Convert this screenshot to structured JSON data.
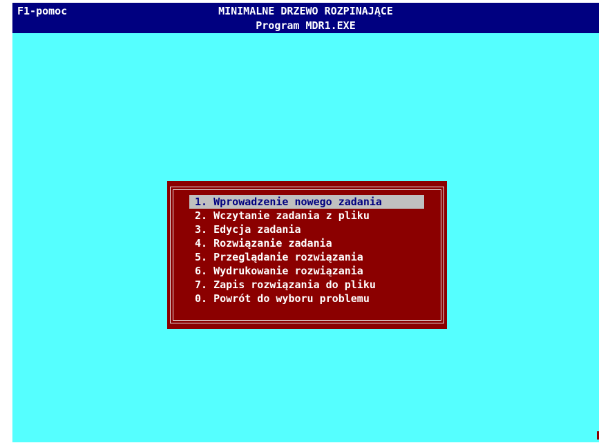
{
  "header": {
    "help_hint": "F1-pomoc",
    "title": "MINIMALNE DRZEWO ROZPINAJĄCE",
    "subtitle": "Program MDR1.EXE"
  },
  "menu": {
    "selected_index": 0,
    "items": [
      {
        "label": "1. Wprowadzenie nowego zadania"
      },
      {
        "label": "2. Wczytanie zadania z pliku"
      },
      {
        "label": "3. Edycja zadania"
      },
      {
        "label": "4. Rozwiązanie zadania"
      },
      {
        "label": "5. Przeglądanie rozwiązania"
      },
      {
        "label": "6. Wydrukowanie rozwiązania"
      },
      {
        "label": "7. Zapis rozwiązania do pliku"
      },
      {
        "label": "0. Powrót do wyboru problemu"
      }
    ]
  },
  "colors": {
    "background": "#55ffff",
    "header": "#000080",
    "menu_box": "#8b0000",
    "highlight": "#c0c0c0"
  }
}
